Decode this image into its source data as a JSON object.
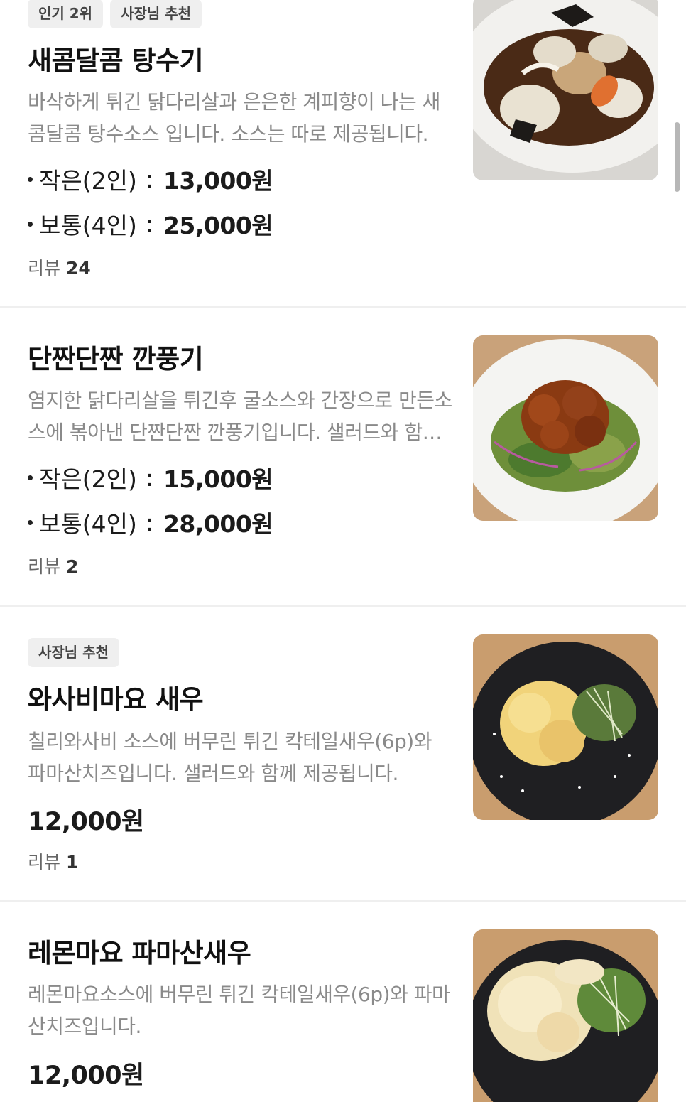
{
  "items": [
    {
      "badges": [
        "인기 2위",
        "사장님 추천"
      ],
      "title": "새콤달콤 탕수기",
      "description": "바삭하게 튀긴  닭다리살과 은은한 계피향이 나는 새콤달콤 탕수소스 입니다. 소스는 따로 제공됩니다.",
      "options": [
        {
          "label": "작은(2인)",
          "sep": ":",
          "price": "13,000원"
        },
        {
          "label": "보통(4인)",
          "sep": ":",
          "price": "25,000원"
        }
      ],
      "review_label": "리뷰",
      "review_count": "24",
      "image": "sweet-sour-chicken-photo"
    },
    {
      "badges": [],
      "title": "단짠단짠 깐풍기",
      "description": "염지한 닭다리살을 튀긴후 굴소스와 간장으로 만든소스에 볶아낸 단짠단짠 깐풍기입니다. 샐러드와 함께 제공됩니다.",
      "options": [
        {
          "label": "작은(2인)",
          "sep": ":",
          "price": "15,000원"
        },
        {
          "label": "보통(4인)",
          "sep": ":",
          "price": "28,000원"
        }
      ],
      "review_label": "리뷰",
      "review_count": "2",
      "image": "kkanpunggi-photo"
    },
    {
      "badges": [
        "사장님 추천"
      ],
      "title": "와사비마요 새우",
      "description": "칠리와사비 소스에 버무린 튀긴 칵테일새우(6p)와 파마산치즈입니다. 샐러드와 함께 제공됩니다.",
      "price": "12,000원",
      "review_label": "리뷰",
      "review_count": "1",
      "image": "wasabi-mayo-shrimp-photo"
    },
    {
      "badges": [],
      "title": "레몬마요 파마산새우",
      "description": "레몬마요소스에 버무린 튀긴 칵테일새우(6p)와 파마산치즈입니다.",
      "price": "12,000원",
      "image": "lemon-mayo-shrimp-photo"
    }
  ],
  "colors": {
    "badge_bg": "#efefef",
    "description_text": "#8a8a8a",
    "divider": "#efefef"
  }
}
